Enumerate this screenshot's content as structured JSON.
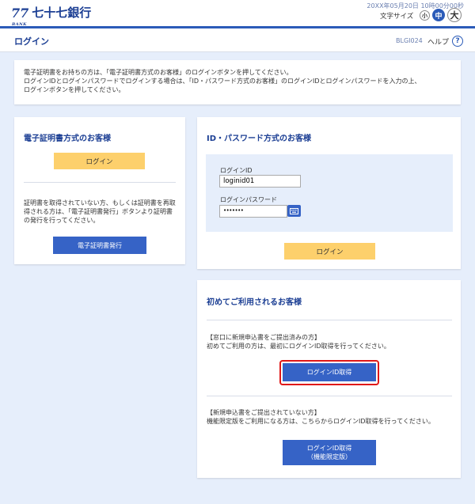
{
  "header": {
    "logo_number": "77",
    "logo_sub": "BANK",
    "bank_name": "七十七銀行",
    "datetime": "20XX年05月20日 10時00分00秒",
    "font_size_label": "文字サイズ",
    "font_small": "小",
    "font_mid": "中",
    "font_large": "大"
  },
  "titlebar": {
    "title": "ログイン",
    "screen_id": "BLGI024",
    "help_label": "ヘルプ",
    "help_icon": "?"
  },
  "notice": {
    "line1": "電子証明書をお持ちの方は、「電子証明書方式のお客様」のログインボタンを押してください。",
    "line2": "ログインIDとログインパスワードでログインする場合は、「ID・パスワード方式のお客様」のログインIDとログインパスワードを入力の上、",
    "line3": "ログインボタンを押してください。"
  },
  "cert": {
    "title": "電子証明書方式のお客様",
    "login_label": "ログイン",
    "desc1": "証明書を取得されていない方、もしくは証明書を再取",
    "desc2": "得される方は、「電子証明書発行」ボタンより証明書",
    "desc3": "の発行を行ってください。",
    "issue_label": "電子証明書発行"
  },
  "idpw": {
    "title": "ID・パスワード方式のお客様",
    "id_label": "ログインID",
    "id_value": "loginid01",
    "pw_label": "ログインパスワード",
    "pw_value": "•••••••",
    "login_label": "ログイン"
  },
  "first": {
    "title": "初めてご利用されるお客様",
    "sec1_head": "【窓口に新規申込書をご提出済みの方】",
    "sec1_desc": "初めてご利用の方は、最初にログインID取得を行ってください。",
    "get_id_label": "ログインID取得",
    "sec2_head": "【新規申込書をご提出されていない方】",
    "sec2_desc": "機能限定版をご利用になる方は、こちらからログインID取得を行ってください。",
    "get_id_limited_line1": "ログインID取得",
    "get_id_limited_line2": "（機能限定版）"
  }
}
